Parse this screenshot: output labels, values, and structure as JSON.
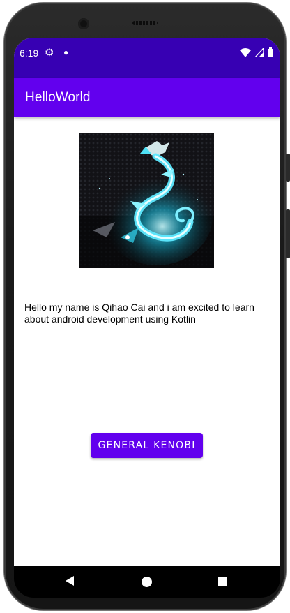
{
  "status_bar": {
    "time": "6:19",
    "icons": [
      "gear-icon",
      "notification-dot-icon",
      "wifi-icon",
      "signal-icon",
      "battery-icon"
    ]
  },
  "app_bar": {
    "title": "HelloWorld"
  },
  "content": {
    "image_description": "dragon-logo-image",
    "intro_text": "Hello my name is Qihao Cai and i am excited to learn about android development using Kotlin",
    "button_label": "GENERAL KENOBI"
  },
  "nav_bar": {
    "icons": [
      "back-icon",
      "home-icon",
      "recents-icon"
    ]
  },
  "colors": {
    "status_bar": "#3700b3",
    "app_bar": "#6200ee",
    "button": "#6200ee",
    "background": "#ffffff",
    "nav_bar": "#000000"
  }
}
